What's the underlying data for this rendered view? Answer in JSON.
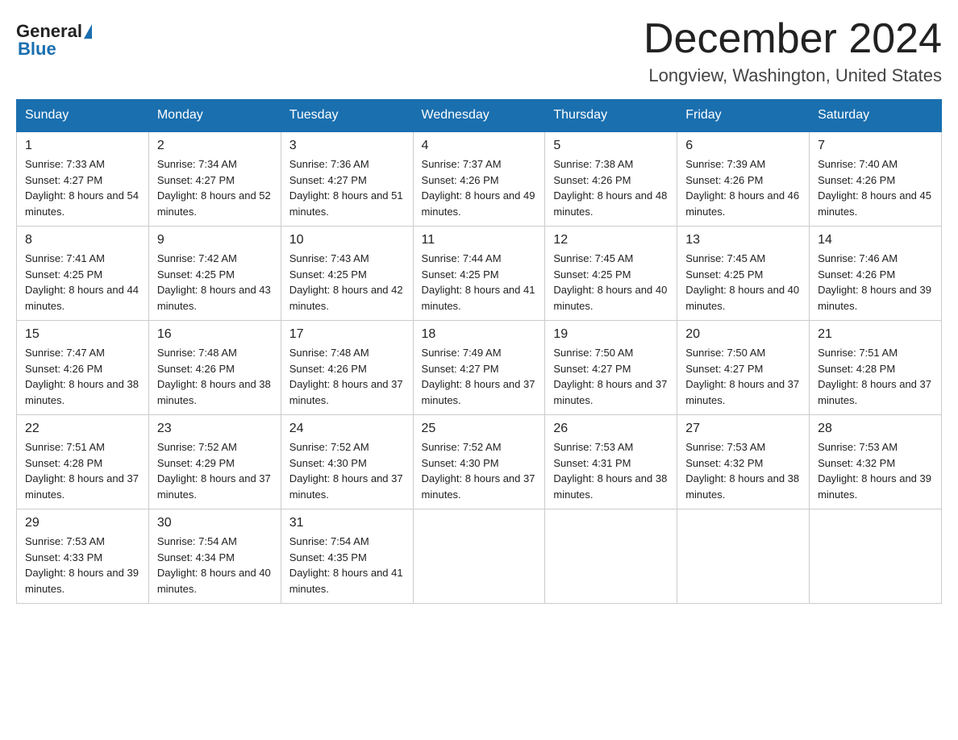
{
  "logo": {
    "general": "General",
    "blue": "Blue"
  },
  "title": {
    "month": "December 2024",
    "location": "Longview, Washington, United States"
  },
  "headers": [
    "Sunday",
    "Monday",
    "Tuesday",
    "Wednesday",
    "Thursday",
    "Friday",
    "Saturday"
  ],
  "weeks": [
    [
      {
        "day": "1",
        "sunrise": "7:33 AM",
        "sunset": "4:27 PM",
        "daylight": "8 hours and 54 minutes."
      },
      {
        "day": "2",
        "sunrise": "7:34 AM",
        "sunset": "4:27 PM",
        "daylight": "8 hours and 52 minutes."
      },
      {
        "day": "3",
        "sunrise": "7:36 AM",
        "sunset": "4:27 PM",
        "daylight": "8 hours and 51 minutes."
      },
      {
        "day": "4",
        "sunrise": "7:37 AM",
        "sunset": "4:26 PM",
        "daylight": "8 hours and 49 minutes."
      },
      {
        "day": "5",
        "sunrise": "7:38 AM",
        "sunset": "4:26 PM",
        "daylight": "8 hours and 48 minutes."
      },
      {
        "day": "6",
        "sunrise": "7:39 AM",
        "sunset": "4:26 PM",
        "daylight": "8 hours and 46 minutes."
      },
      {
        "day": "7",
        "sunrise": "7:40 AM",
        "sunset": "4:26 PM",
        "daylight": "8 hours and 45 minutes."
      }
    ],
    [
      {
        "day": "8",
        "sunrise": "7:41 AM",
        "sunset": "4:25 PM",
        "daylight": "8 hours and 44 minutes."
      },
      {
        "day": "9",
        "sunrise": "7:42 AM",
        "sunset": "4:25 PM",
        "daylight": "8 hours and 43 minutes."
      },
      {
        "day": "10",
        "sunrise": "7:43 AM",
        "sunset": "4:25 PM",
        "daylight": "8 hours and 42 minutes."
      },
      {
        "day": "11",
        "sunrise": "7:44 AM",
        "sunset": "4:25 PM",
        "daylight": "8 hours and 41 minutes."
      },
      {
        "day": "12",
        "sunrise": "7:45 AM",
        "sunset": "4:25 PM",
        "daylight": "8 hours and 40 minutes."
      },
      {
        "day": "13",
        "sunrise": "7:45 AM",
        "sunset": "4:25 PM",
        "daylight": "8 hours and 40 minutes."
      },
      {
        "day": "14",
        "sunrise": "7:46 AM",
        "sunset": "4:26 PM",
        "daylight": "8 hours and 39 minutes."
      }
    ],
    [
      {
        "day": "15",
        "sunrise": "7:47 AM",
        "sunset": "4:26 PM",
        "daylight": "8 hours and 38 minutes."
      },
      {
        "day": "16",
        "sunrise": "7:48 AM",
        "sunset": "4:26 PM",
        "daylight": "8 hours and 38 minutes."
      },
      {
        "day": "17",
        "sunrise": "7:48 AM",
        "sunset": "4:26 PM",
        "daylight": "8 hours and 37 minutes."
      },
      {
        "day": "18",
        "sunrise": "7:49 AM",
        "sunset": "4:27 PM",
        "daylight": "8 hours and 37 minutes."
      },
      {
        "day": "19",
        "sunrise": "7:50 AM",
        "sunset": "4:27 PM",
        "daylight": "8 hours and 37 minutes."
      },
      {
        "day": "20",
        "sunrise": "7:50 AM",
        "sunset": "4:27 PM",
        "daylight": "8 hours and 37 minutes."
      },
      {
        "day": "21",
        "sunrise": "7:51 AM",
        "sunset": "4:28 PM",
        "daylight": "8 hours and 37 minutes."
      }
    ],
    [
      {
        "day": "22",
        "sunrise": "7:51 AM",
        "sunset": "4:28 PM",
        "daylight": "8 hours and 37 minutes."
      },
      {
        "day": "23",
        "sunrise": "7:52 AM",
        "sunset": "4:29 PM",
        "daylight": "8 hours and 37 minutes."
      },
      {
        "day": "24",
        "sunrise": "7:52 AM",
        "sunset": "4:30 PM",
        "daylight": "8 hours and 37 minutes."
      },
      {
        "day": "25",
        "sunrise": "7:52 AM",
        "sunset": "4:30 PM",
        "daylight": "8 hours and 37 minutes."
      },
      {
        "day": "26",
        "sunrise": "7:53 AM",
        "sunset": "4:31 PM",
        "daylight": "8 hours and 38 minutes."
      },
      {
        "day": "27",
        "sunrise": "7:53 AM",
        "sunset": "4:32 PM",
        "daylight": "8 hours and 38 minutes."
      },
      {
        "day": "28",
        "sunrise": "7:53 AM",
        "sunset": "4:32 PM",
        "daylight": "8 hours and 39 minutes."
      }
    ],
    [
      {
        "day": "29",
        "sunrise": "7:53 AM",
        "sunset": "4:33 PM",
        "daylight": "8 hours and 39 minutes."
      },
      {
        "day": "30",
        "sunrise": "7:54 AM",
        "sunset": "4:34 PM",
        "daylight": "8 hours and 40 minutes."
      },
      {
        "day": "31",
        "sunrise": "7:54 AM",
        "sunset": "4:35 PM",
        "daylight": "8 hours and 41 minutes."
      },
      null,
      null,
      null,
      null
    ]
  ],
  "labels": {
    "sunrise": "Sunrise:",
    "sunset": "Sunset:",
    "daylight": "Daylight:"
  }
}
